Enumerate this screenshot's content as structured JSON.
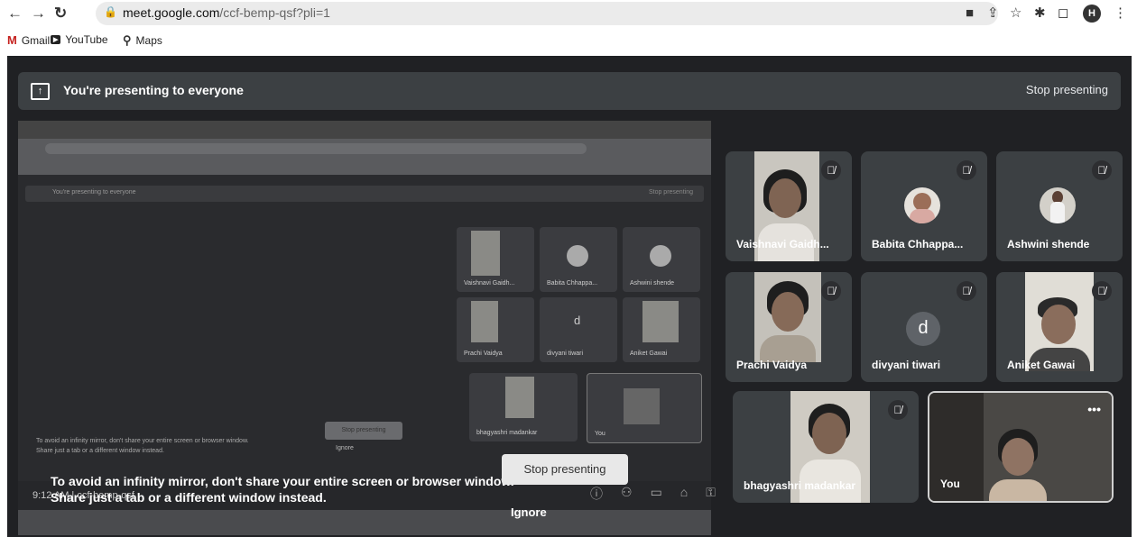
{
  "browser": {
    "url_host": "meet.google.com",
    "url_rest": "/ccf-bemp-qsf?pli=1",
    "profile_initial": "H",
    "bookmarks": [
      {
        "label": "Gmail",
        "icon": "gmail-icon"
      },
      {
        "label": "YouTube",
        "icon": "youtube-icon"
      },
      {
        "label": "Maps",
        "icon": "maps-icon"
      }
    ]
  },
  "banner": {
    "text": "You're presenting to everyone",
    "stop_label": "Stop presenting"
  },
  "mirror": {
    "banner_text": "You're presenting to everyone",
    "banner_stop": "Stop presenting",
    "warn_line1": "To avoid an infinity mirror, don't share your entire screen or browser window.",
    "warn_line2": "Share just a tab or a different window instead.",
    "stop_button": "Stop presenting",
    "ignore": "Ignore",
    "time": "9:12 AM",
    "meeting_code": "ccf-bemp-qsf",
    "tiles": [
      "Vaishnavi Gaidh...",
      "Babita Chhappa...",
      "Ashwini shende",
      "Prachi Vaidya",
      "divyani tiwari",
      "Aniket Gawai",
      "bhagyashri madankar",
      "You"
    ]
  },
  "overlay": {
    "warn_line1": "To avoid an infinity mirror, don't share your entire screen or browser window.",
    "warn_line2": "Share just a tab or a different window instead.",
    "stop_button": "Stop presenting",
    "ignore": "Ignore"
  },
  "participants": [
    {
      "name": "Vaishnavi Gaidh...",
      "muted": true,
      "type": "video"
    },
    {
      "name": "Babita Chhappa...",
      "muted": true,
      "type": "avatar"
    },
    {
      "name": "Ashwini shende",
      "muted": true,
      "type": "avatar"
    },
    {
      "name": "Prachi Vaidya",
      "muted": true,
      "type": "video"
    },
    {
      "name": "divyani tiwari",
      "muted": true,
      "type": "letter",
      "letter": "d"
    },
    {
      "name": "Aniket Gawai",
      "muted": true,
      "type": "video"
    },
    {
      "name": "bhagyashri madankar",
      "muted": true,
      "type": "video"
    },
    {
      "name": "You",
      "muted": false,
      "type": "video"
    }
  ]
}
